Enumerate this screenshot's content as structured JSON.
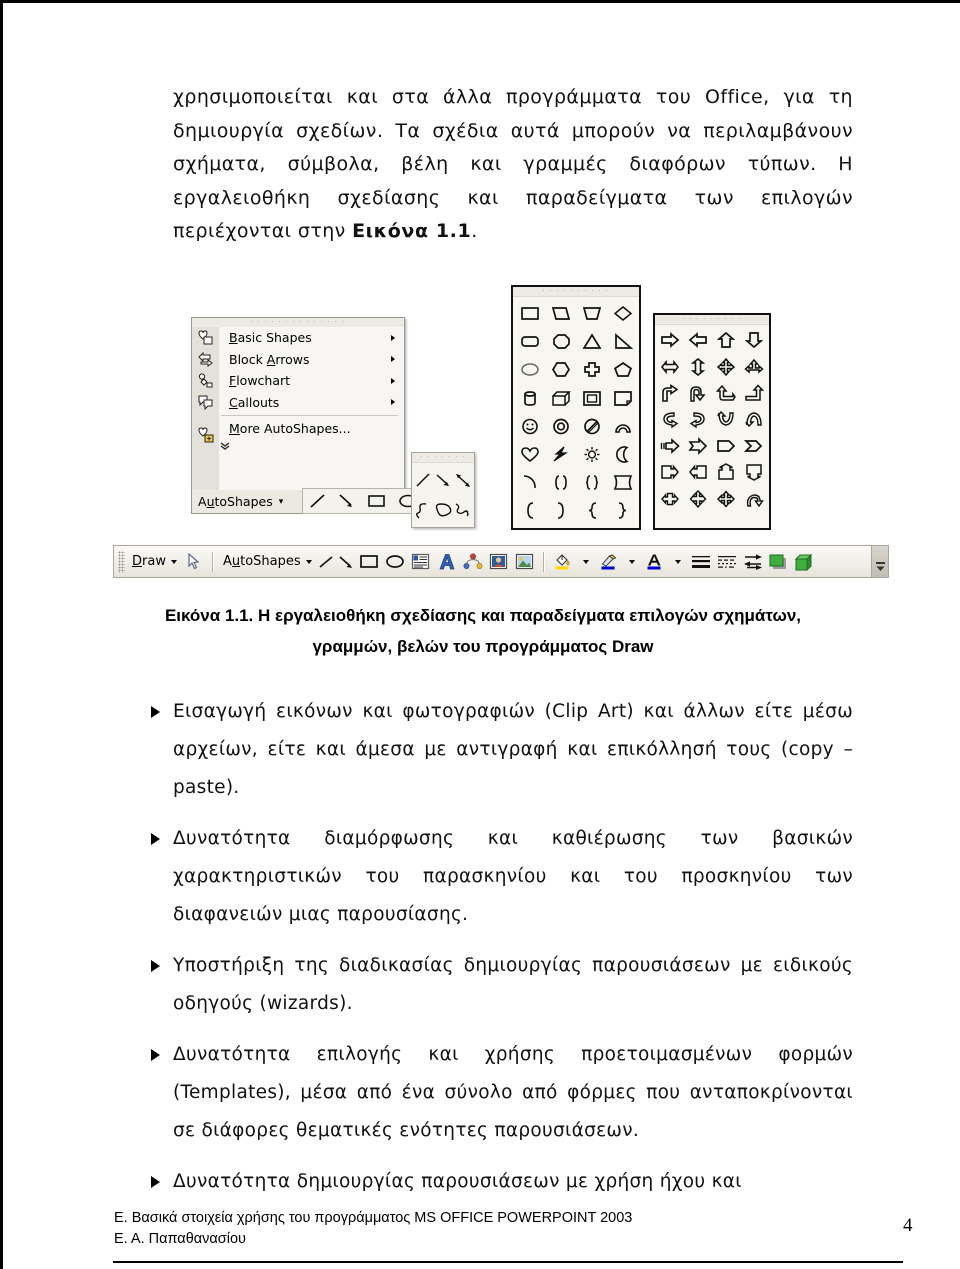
{
  "document": {
    "paragraphs": [
      "χρησιμοποιείται και στα άλλα προγράμματα του Office, για τη δημιουργία σχεδίων. Τα σχέδια αυτά μπορούν να περιλαμβάνουν σχήματα, σύμβολα, βέλη και γραμμές διαφόρων τύπων. Η εργαλειοθήκη σχεδίασης και παραδείγματα των επιλογών περιέχονται στην "
    ],
    "paragraph_bold_tail": "Εικόνα 1.1",
    "paragraph_tail_punct": ".",
    "caption_line1": "Εικόνα 1.1. Η εργαλειοθήκη σχεδίασης και παραδείγματα επιλογών σχημάτων,",
    "caption_line2": "γραμμών, βελών του προγράμματος Draw",
    "bullets": [
      "Εισαγωγή εικόνων και φωτογραφιών (Clip Art) και άλλων είτε μέσω αρχείων, είτε και άμεσα με αντιγραφή και επικόλλησή τους (copy – paste).",
      "Δυνατότητα διαμόρφωσης και καθιέρωσης των βασικών χαρακτηριστικών του παρασκηνίου και του προσκηνίου των διαφανειών μιας παρουσίασης.",
      "Υποστήριξη της διαδικασίας δημιουργίας παρουσιάσεων με ειδικούς οδηγούς (wizards).",
      "Δυνατότητα επιλογής και χρήσης προετοιμασμένων φορμών (Templates), μέσα από ένα σύνολο από φόρμες που ανταποκρίνονται σε διάφορες θεματικές ενότητες παρουσιάσεων.",
      "Δυνατότητα δημιουργίας παρουσιάσεων με χρήση ήχου και"
    ],
    "footer_line1": "Ε. Βασικά στοιχεία χρήσης του προγράμματος MS OFFICE POWERPOINT 2003",
    "footer_line2": "Ε. Α. Παπαθανασίου",
    "page_number": "4"
  },
  "figure": {
    "autoshapes_menu": {
      "items": [
        {
          "label": "Basic Shapes",
          "accel": "B",
          "has_submenu": true,
          "icon": "basic-shapes-icon"
        },
        {
          "label": "Block Arrows",
          "accel": "A",
          "has_submenu": true,
          "icon": "block-arrows-icon"
        },
        {
          "label": "Flowchart",
          "accel": "F",
          "has_submenu": true,
          "icon": "flowchart-icon"
        },
        {
          "label": "Callouts",
          "accel": "C",
          "has_submenu": true,
          "icon": "callouts-icon"
        },
        {
          "label": "More AutoShapes...",
          "accel": "M",
          "has_submenu": false,
          "icon": "more-autoshapes-icon"
        }
      ],
      "expand_chevron": "⌄"
    },
    "autoshapes_bar": {
      "label": "AutoShapes",
      "caret": "▾",
      "tools": [
        "line-icon",
        "arrow-icon",
        "rectangle-icon",
        "oval-icon"
      ]
    },
    "lines_flyout": {
      "tools": [
        "line-icon",
        "arrow-icon",
        "double-arrow-icon",
        "curve-icon",
        "freeform-icon",
        "scribble-icon"
      ]
    },
    "gallery_basic_shapes": {
      "title": "Basic Shapes",
      "shapes": [
        "rectangle",
        "parallelogram",
        "trapezoid",
        "diamond",
        "rounded-rectangle",
        "octagon",
        "triangle",
        "right-triangle",
        "ellipse",
        "hexagon",
        "cross",
        "pentagon",
        "cylinder",
        "cube",
        "bevel",
        "folded-corner",
        "smiley-face",
        "donut",
        "no-symbol",
        "block-arc",
        "heart",
        "lightning-bolt",
        "sun",
        "moon",
        "arc",
        "double-bracket",
        "double-brace",
        "plaque",
        "left-bracket",
        "right-bracket",
        "left-brace",
        "right-brace"
      ]
    },
    "gallery_block_arrows": {
      "title": "Block Arrows",
      "shapes": [
        "right-arrow",
        "left-arrow",
        "up-arrow",
        "down-arrow",
        "left-right-arrow",
        "up-down-arrow",
        "quad-arrow",
        "left-right-up-arrow",
        "bent-arrow",
        "u-turn-arrow",
        "left-up-arrow",
        "bent-up-arrow",
        "curved-left-arrow",
        "curved-right-arrow",
        "curved-down-arrow",
        "curved-up-arrow",
        "striped-right-arrow",
        "notched-right-arrow",
        "pentagon-arrow",
        "chevron-arrow",
        "right-arrow-callout",
        "left-arrow-callout",
        "up-arrow-callout",
        "down-arrow-callout",
        "left-right-arrow-callout",
        "quad-arrow-callout",
        "cross-arrow",
        "circular-arrow"
      ]
    },
    "drawing_toolbar": {
      "draw_label": "Draw",
      "draw_accel": "D",
      "autoshapes_label": "AutoShapes",
      "autoshapes_accel": "A",
      "buttons": [
        "select-objects-icon",
        "line-icon",
        "arrow-icon",
        "rectangle-icon",
        "oval-icon",
        "text-box-icon",
        "wordart-icon",
        "diagram-icon",
        "clip-art-icon",
        "picture-icon",
        "fill-color-icon",
        "line-color-icon",
        "font-color-icon",
        "line-style-icon",
        "dash-style-icon",
        "arrow-style-icon",
        "shadow-style-icon",
        "3d-style-icon",
        "toolbar-overflow-icon"
      ],
      "colors": {
        "fill_color": "#ffd800",
        "line_color": "#0000cc",
        "font_color": "#0000cc",
        "shadow_3d_green": "#2fa02f"
      }
    }
  }
}
